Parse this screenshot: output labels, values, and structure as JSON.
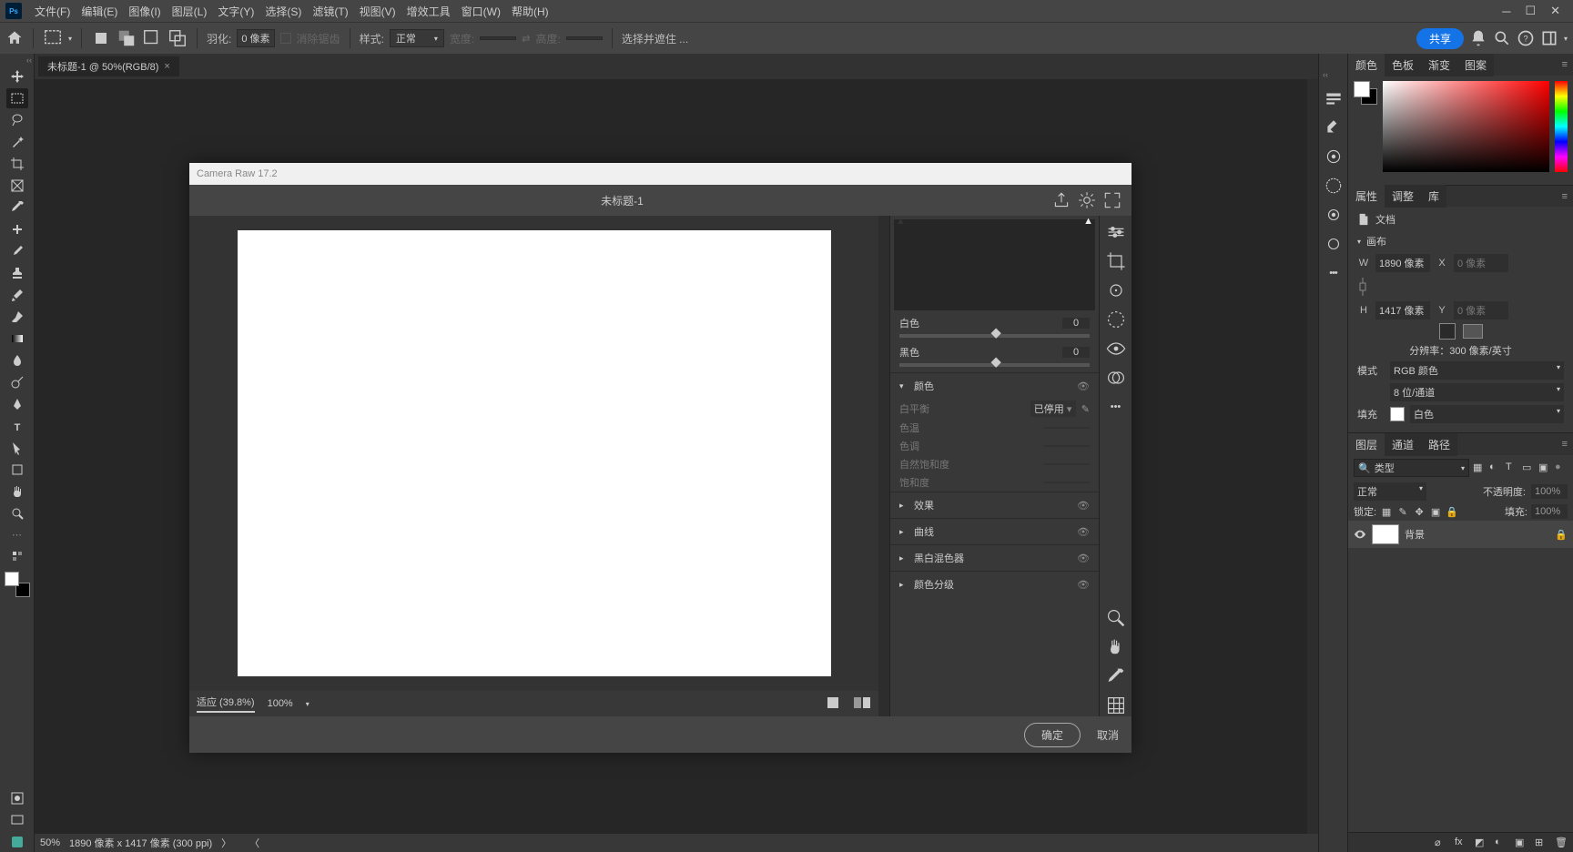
{
  "menubar": {
    "items": [
      "文件(F)",
      "编辑(E)",
      "图像(I)",
      "图层(L)",
      "文字(Y)",
      "选择(S)",
      "滤镜(T)",
      "视图(V)",
      "增效工具",
      "窗口(W)",
      "帮助(H)"
    ]
  },
  "optbar": {
    "feather_label": "羽化:",
    "feather_value": "0 像素",
    "antialias": "消除锯齿",
    "style_label": "样式:",
    "style_value": "正常",
    "width_label": "宽度:",
    "height_label": "高度:",
    "mask_label": "选择并遮住 ...",
    "share": "共享"
  },
  "tab": {
    "title": "未标题-1 @ 50%(RGB/8)"
  },
  "statusbar": {
    "zoom": "50%",
    "dims": "1890 像素 x 1417 像素 (300 ppi)"
  },
  "right": {
    "color_tabs": [
      "颜色",
      "色板",
      "渐变",
      "图案"
    ],
    "prop_tabs": [
      "属性",
      "调整",
      "库"
    ],
    "doc_label": "文档",
    "canvas_label": "画布",
    "w_label": "W",
    "w_val": "1890 像素",
    "x_label": "X",
    "x_ph": "0 像素",
    "h_label": "H",
    "h_val": "1417 像素",
    "y_label": "Y",
    "y_ph": "0 像素",
    "res_label": "分辨率：300 像素/英寸",
    "mode_label": "模式",
    "mode_val": "RGB 颜色",
    "bit_val": "8 位/通道",
    "fill_label": "填充",
    "fill_val": "白色",
    "layers_tabs": [
      "图层",
      "通道",
      "路径"
    ],
    "kind_label": "类型",
    "blend": "正常",
    "opacity_label": "不透明度:",
    "opacity_val": "100%",
    "lock_label": "锁定:",
    "fill_lbl": "填充:",
    "fill_pc": "100%",
    "layer_name": "背景"
  },
  "cr": {
    "title": "Camera Raw 17.2",
    "doc": "未标题-1",
    "sliders": {
      "white_label": "白色",
      "white_val": "0",
      "black_label": "黑色",
      "black_val": "0"
    },
    "color_section": "颜色",
    "wb_label": "白平衡",
    "wb_val": "已停用",
    "temp": "色温",
    "tint": "色调",
    "nvib": "自然饱和度",
    "vib": "饱和度",
    "effects": "效果",
    "curves": "曲线",
    "mixer": "黑白混色器",
    "grading": "颜色分级",
    "zoom_fit": "适应  (39.8%)",
    "zoom_100": "100%",
    "ok": "确定",
    "cancel": "取消"
  }
}
